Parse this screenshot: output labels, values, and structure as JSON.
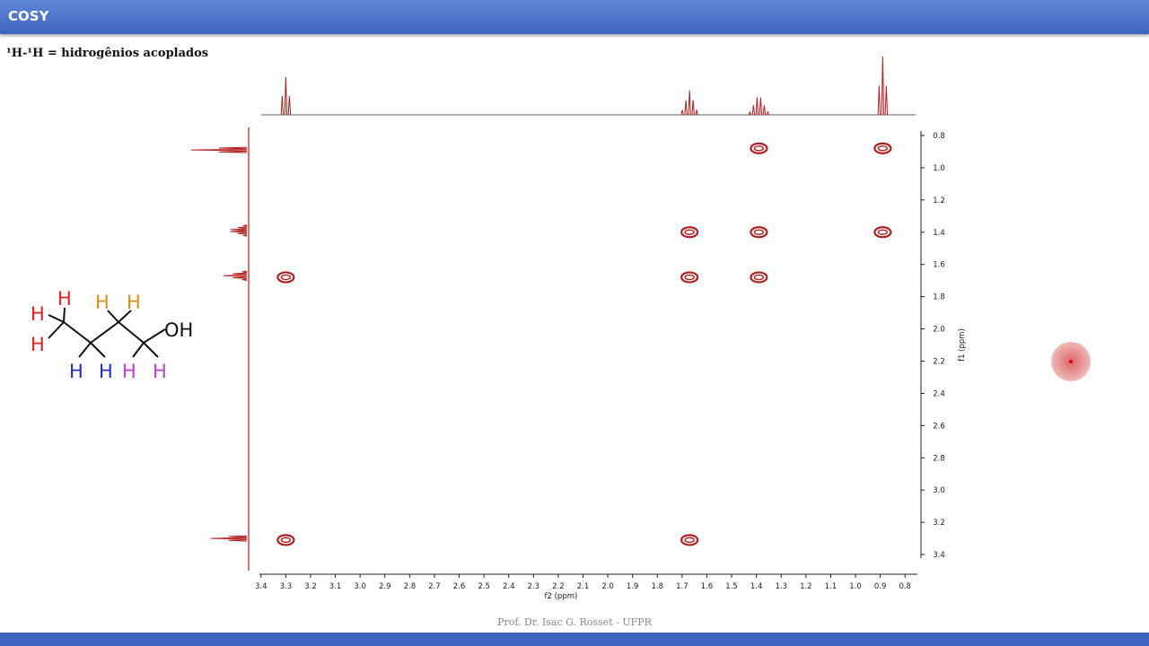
{
  "header": {
    "title": "COSY"
  },
  "subtitle": "¹H-¹H = hidrogênios acoplados",
  "footer": {
    "credit": "Prof. Dr. Isac G. Rosset - UFPR"
  },
  "molecule": {
    "oh_label": "OH",
    "h_label": "H",
    "colors": {
      "ch3": "#e0201e",
      "ch2a": "#e48a1e",
      "ch2b": "#1e2fb8",
      "ch2c": "#c23bd6",
      "oh": "#111111"
    }
  },
  "colors": {
    "accent": "#3e66c0",
    "peak": "#b21e1e"
  },
  "chart_data": {
    "type": "scatter",
    "title": "",
    "xlabel": "f2 (ppm)",
    "ylabel": "f1 (ppm)",
    "xlim": [
      3.45,
      0.75
    ],
    "ylim": [
      0.75,
      3.5
    ],
    "x_ticks": [
      3.4,
      3.3,
      3.2,
      3.1,
      3.0,
      2.9,
      2.8,
      2.7,
      2.6,
      2.5,
      2.4,
      2.3,
      2.2,
      2.1,
      2.0,
      1.9,
      1.8,
      1.7,
      1.6,
      1.5,
      1.4,
      1.3,
      1.2,
      1.1,
      1.0,
      0.9,
      0.8
    ],
    "y_ticks": [
      0.8,
      1.0,
      1.2,
      1.4,
      1.6,
      1.8,
      2.0,
      2.2,
      2.4,
      2.6,
      2.8,
      3.0,
      3.2,
      3.4
    ],
    "grid": false,
    "cross_peaks": [
      {
        "x": 1.39,
        "y": 0.88
      },
      {
        "x": 0.89,
        "y": 0.88
      },
      {
        "x": 1.67,
        "y": 1.4
      },
      {
        "x": 1.39,
        "y": 1.4
      },
      {
        "x": 0.89,
        "y": 1.4
      },
      {
        "x": 3.3,
        "y": 1.68
      },
      {
        "x": 1.67,
        "y": 1.68
      },
      {
        "x": 1.39,
        "y": 1.68
      },
      {
        "x": 3.3,
        "y": 3.31
      },
      {
        "x": 1.67,
        "y": 3.31
      }
    ],
    "projection_1d": [
      {
        "shift": 3.3,
        "multiplicity": "t",
        "intensity": 0.65
      },
      {
        "shift": 1.67,
        "multiplicity": "quintet",
        "intensity": 0.42
      },
      {
        "shift": 1.39,
        "multiplicity": "sextet",
        "intensity": 0.33
      },
      {
        "shift": 0.89,
        "multiplicity": "t",
        "intensity": 1.0
      }
    ]
  }
}
